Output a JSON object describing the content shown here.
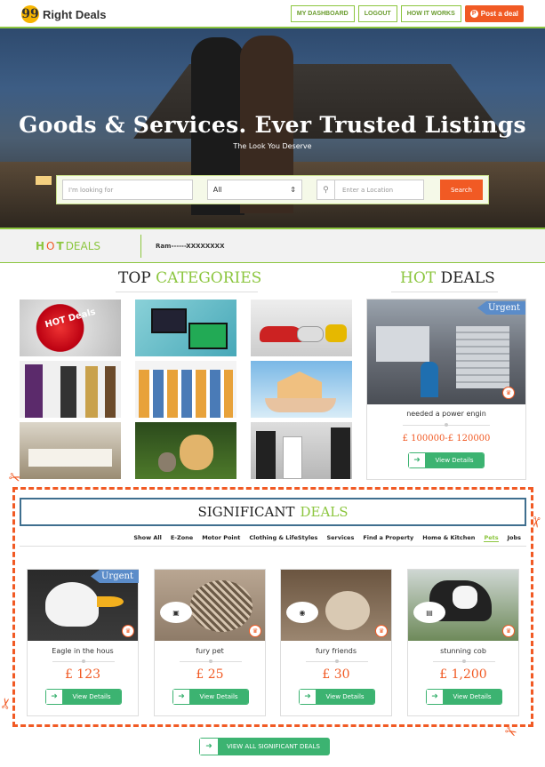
{
  "header": {
    "logo_glyph": "99",
    "logo_text": "Right Deals",
    "nav": [
      "MY DASHBOARD",
      "LOGOUT",
      "HOW IT WORKS"
    ],
    "post_label": "Post a deal"
  },
  "hero": {
    "title": "Goods & Services. Ever Trusted Listings",
    "subtitle": "The Look You Deserve",
    "search_placeholder": "I'm looking for",
    "select_value": "All",
    "location_placeholder": "Enter a Location",
    "search_button": "Search"
  },
  "strip": {
    "logo_h": "H",
    "logo_o": "O",
    "logo_t": "T",
    "logo_deals": "DEALS",
    "ticker": "Ram------XXXXXXXX"
  },
  "categories": {
    "title_a": "TOP",
    "title_b": "CATEGORIES",
    "hot_badge": "HOT Deals"
  },
  "hot_deals": {
    "title_a": "HOT",
    "title_b": "DEALS",
    "urgent": "Urgent",
    "name": "needed a power engin",
    "price": "£ 100000-£ 120000",
    "button": "View Details"
  },
  "significant": {
    "title_a": "SIGNIFICANT",
    "title_b": "DEALS",
    "tabs": [
      "Show All",
      "E-Zone",
      "Motor Point",
      "Clothing & LifeStyles",
      "Services",
      "Find a Property",
      "Home & Kitchen",
      "Pets",
      "Jobs"
    ],
    "active_tab": "Pets",
    "deals": [
      {
        "name": "Eagle in the hous",
        "price": "£ 123",
        "urgent": "Urgent",
        "button": "View Details"
      },
      {
        "name": "fury pet",
        "price": "£ 25",
        "button": "View Details"
      },
      {
        "name": "fury friends",
        "price": "£ 30",
        "button": "View Details"
      },
      {
        "name": "stunning cob",
        "price": "£ 1,200",
        "button": "View Details"
      }
    ],
    "all_button": "View all significant deals"
  },
  "colors": {
    "accent_green": "#8cc63f",
    "accent_orange": "#f15a24",
    "button_green": "#3cb371",
    "urgent_blue": "#5b8cc9"
  }
}
